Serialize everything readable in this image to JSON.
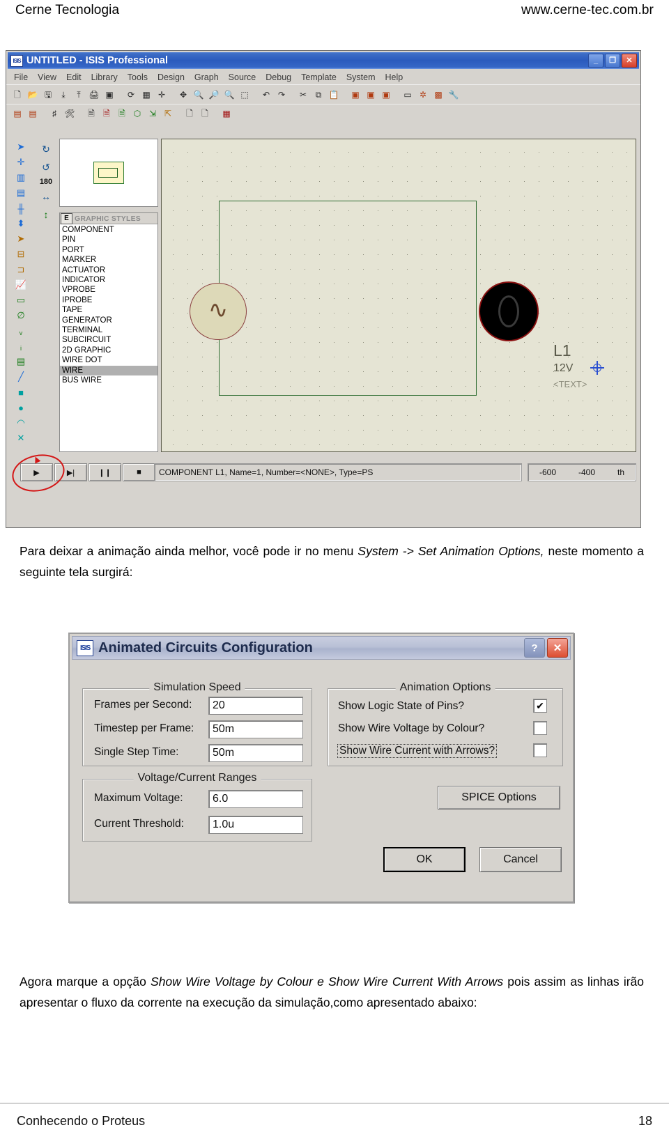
{
  "page_header": {
    "company": "Cerne Tecnologia",
    "website": "www.cerne-tec.com.br"
  },
  "isis_window": {
    "title": "UNTITLED - ISIS Professional",
    "app_icon_label": "ISIS",
    "window_buttons": {
      "minimize": "_",
      "maximize": "❐",
      "close": "✕"
    },
    "menu": [
      "File",
      "View",
      "Edit",
      "Library",
      "Tools",
      "Design",
      "Graph",
      "Source",
      "Debug",
      "Template",
      "System",
      "Help"
    ],
    "toolbar_row1": [
      "new-icon",
      "open-icon",
      "save-icon",
      "import-icon",
      "export-icon",
      "print-icon",
      "print-area-icon",
      "sep",
      "refresh-icon",
      "grid-icon",
      "origin-icon",
      "sep",
      "pan-icon",
      "zoom-in-icon",
      "zoom-out-icon",
      "zoom-area-icon",
      "zoom-all-icon",
      "sep",
      "undo-icon",
      "redo-icon",
      "sep",
      "cut-icon",
      "copy-icon",
      "paste-icon",
      "sep",
      "block-copy-icon",
      "block-move-icon",
      "block-delete-icon",
      "sep",
      "pick-device-icon",
      "make-device-icon",
      "packaging-icon",
      "decompose-icon"
    ],
    "toolbar_row2": [
      "wire-label-icon",
      "script-icon",
      "bill-materials-icon",
      "erc-icon",
      "netlist-icon",
      "netlist-compile-icon",
      "model-icon",
      "3d-icon",
      "goto-sheet-icon",
      "exit-sheet-icon",
      "new-sheet-icon",
      "remove-sheet-icon",
      "grid-snap-icon"
    ],
    "vertical_tools": [
      "selection-mode-icon",
      "component-mode-icon",
      "junction-dot-icon",
      "wire-label-mode-icon",
      "text-script-icon",
      "bus-mode-icon",
      "subcircuit-icon",
      "terminal-mode-icon",
      "device-pin-icon",
      "graph-mode-icon",
      "tape-recorder-icon",
      "generator-mode-icon",
      "voltage-probe-icon",
      "current-probe-icon",
      "virtual-instrument-icon",
      "line-tool-icon",
      "box-tool-icon",
      "circle-tool-icon",
      "arc-tool-icon",
      "path-tool-icon"
    ],
    "orientation": {
      "rotate_cw": "rotate-clockwise-icon",
      "rotate_ccw": "rotate-counterclockwise-icon",
      "angle_label": "180",
      "mirror_x": "mirror-horizontal-icon",
      "mirror_y": "mirror-vertical-icon"
    },
    "object_selector": {
      "edit_button": "E",
      "header": "GRAPHIC STYLES",
      "items": [
        "COMPONENT",
        "PIN",
        "PORT",
        "MARKER",
        "ACTUATOR",
        "INDICATOR",
        "VPROBE",
        "IPROBE",
        "TAPE",
        "GENERATOR",
        "TERMINAL",
        "SUBCIRCUIT",
        "2D GRAPHIC",
        "WIRE DOT",
        "WIRE",
        "BUS WIRE"
      ],
      "selected": "WIRE"
    },
    "schematic": {
      "component_ref": "L1",
      "component_value": "12V",
      "component_text": "<TEXT>"
    },
    "animation_controls": {
      "play": "▶",
      "step": "▶|",
      "pause": "❙❙",
      "stop": "■"
    },
    "status": {
      "message": "COMPONENT L1, Name=1, Number=<NONE>, Type=PS",
      "x_coord": "-600",
      "y_coord": "-400",
      "units": "th"
    }
  },
  "paragraph_1": {
    "text_a": "Para deixar a animação ainda melhor, você pode ir no menu ",
    "text_b": "System -> Set Animation Options,",
    "text_c": " neste momento a seguinte tela surgirá:"
  },
  "dialog": {
    "title": "Animated Circuits Configuration",
    "icon_label": "ISIS",
    "help_button": "?",
    "close_button": "✕",
    "simulation_speed": {
      "group_label": "Simulation Speed",
      "fields": [
        {
          "label": "Frames per Second:",
          "value": "20"
        },
        {
          "label": "Timestep per Frame:",
          "value": "50m"
        },
        {
          "label": "Single Step Time:",
          "value": "50m"
        }
      ]
    },
    "voltage_current_ranges": {
      "group_label": "Voltage/Current Ranges",
      "fields": [
        {
          "label": "Maximum Voltage:",
          "value": "6.0"
        },
        {
          "label": "Current Threshold:",
          "value": "1.0u"
        }
      ]
    },
    "animation_options": {
      "group_label": "Animation Options",
      "options": [
        {
          "label": "Show Logic State of Pins?",
          "checked": true,
          "mark": "✔"
        },
        {
          "label": "Show Wire Voltage by Colour?",
          "checked": false,
          "mark": ""
        },
        {
          "label": "Show Wire Current with Arrows?",
          "checked": false,
          "mark": ""
        }
      ]
    },
    "buttons": {
      "spice": "SPICE Options",
      "ok": "OK",
      "cancel": "Cancel"
    }
  },
  "paragraph_2": {
    "text_a": "Agora marque a opção ",
    "text_b": "Show Wire Voltage by Colour e Show Wire Current With Arrows",
    "text_c": " pois assim as linhas irão apresentar o fluxo da corrente na execução da simulação,como apresentado abaixo:"
  },
  "footer": {
    "left": "Conhecendo o Proteus",
    "page_number": "18"
  }
}
